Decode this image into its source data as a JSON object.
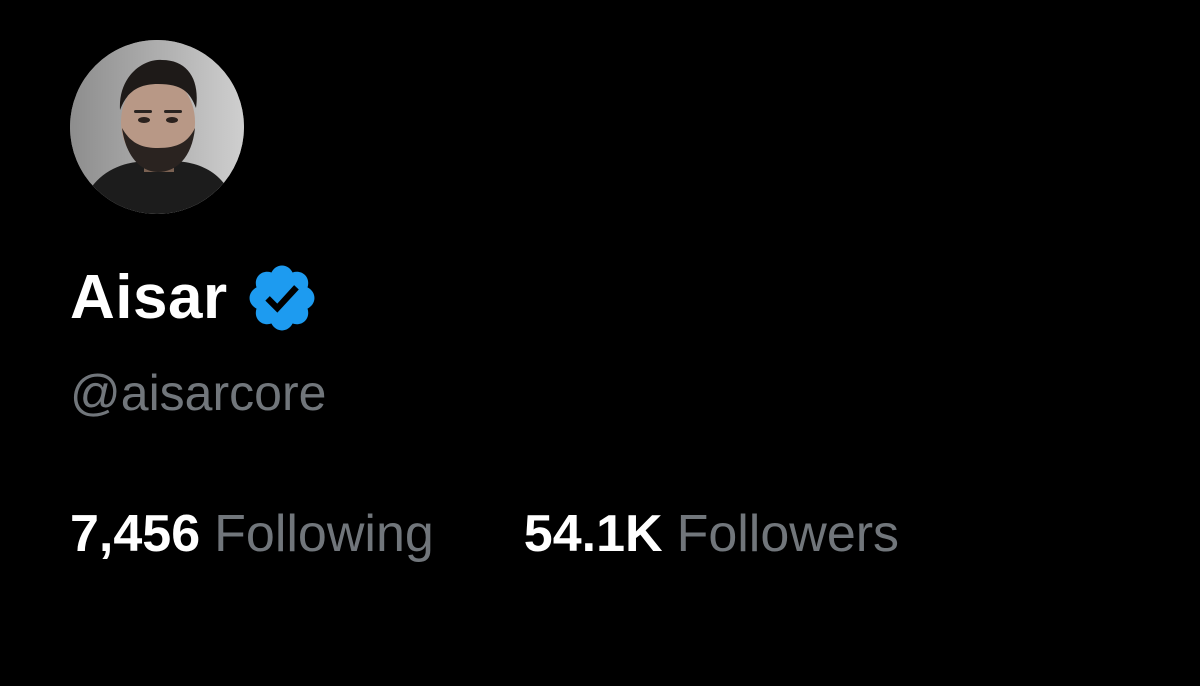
{
  "profile": {
    "display_name": "Aisar",
    "handle": "@aisarcore",
    "verified": true,
    "avatar_icon": "avatar-photo-icon",
    "badge_icon": "verified-badge-icon"
  },
  "stats": {
    "following_count": "7,456",
    "following_label": "Following",
    "followers_count": "54.1K",
    "followers_label": "Followers"
  },
  "colors": {
    "background": "#000000",
    "primary_text": "#ffffff",
    "secondary_text": "#71767b",
    "verified_blue": "#1d9bf0"
  }
}
